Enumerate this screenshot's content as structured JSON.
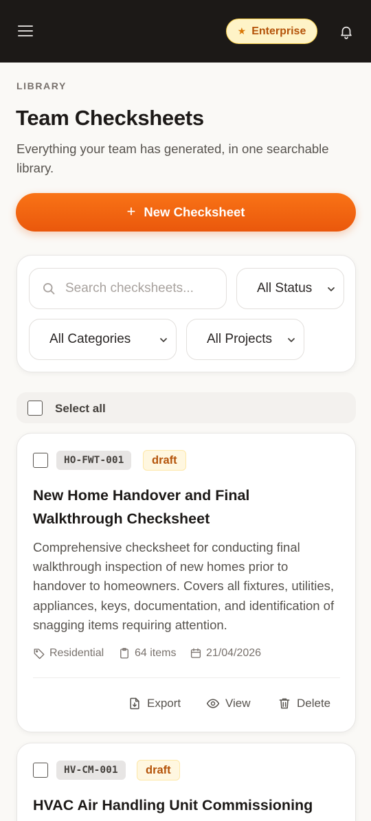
{
  "header": {
    "plan_badge": "Enterprise",
    "icons": {
      "menu": "hamburger-menu-icon",
      "plan": "star-icon",
      "notifications": "bell-icon"
    }
  },
  "page": {
    "overline": "LIBRARY",
    "title": "Team Checksheets",
    "subtitle": "Everything your team has generated, in one searchable library.",
    "new_button": "New Checksheet",
    "new_button_icon": "+"
  },
  "filters": {
    "search_placeholder": "Search checksheets...",
    "status": "All Status",
    "category": "All Categories",
    "project": "All Projects"
  },
  "select_all_label": "Select all",
  "checksheets": [
    {
      "code": "HO-FWT-001",
      "status": "draft",
      "title": "New Home Handover and Final Walkthrough Checksheet",
      "description": "Comprehensive checksheet for conducting final walkthrough inspection of new homes prior to handover to homeowners. Covers all fixtures, utilities, appliances, keys, documentation, and identification of snagging items requiring attention.",
      "category": "Residential",
      "items": "64 items",
      "date": "21/04/2026",
      "actions": {
        "export": "Export",
        "view": "View",
        "delete": "Delete"
      }
    },
    {
      "code": "HV-CM-001",
      "status": "draft",
      "title": "HVAC Air Handling Unit Commissioning"
    }
  ],
  "colors": {
    "accent": "#f97316",
    "topbar": "#1c1917",
    "badge_bg": "#fef3c7",
    "badge_text": "#b45309",
    "background": "#faf9f6"
  }
}
